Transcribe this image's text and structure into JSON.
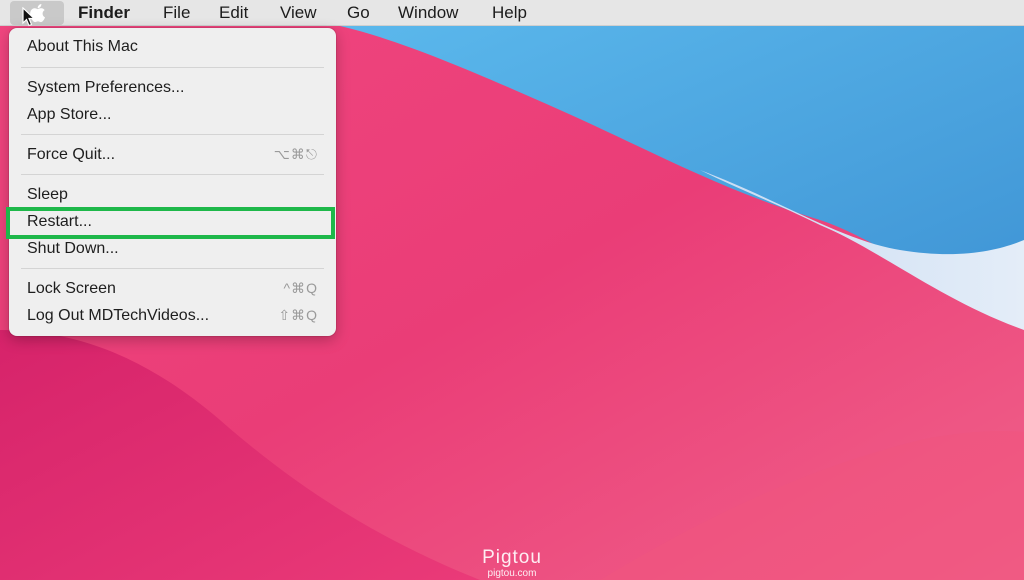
{
  "menubar": {
    "apple_icon": "apple-logo-icon",
    "items": [
      "Finder",
      "File",
      "Edit",
      "View",
      "Go",
      "Window",
      "Help"
    ]
  },
  "apple_menu": {
    "items": [
      {
        "label": "About This Mac",
        "shortcut": ""
      },
      {
        "label": "System Preferences...",
        "shortcut": ""
      },
      {
        "label": "App Store...",
        "shortcut": ""
      },
      {
        "label": "Force Quit...",
        "shortcut": "⌥⌘⎋"
      },
      {
        "label": "Sleep",
        "shortcut": ""
      },
      {
        "label": "Restart...",
        "shortcut": ""
      },
      {
        "label": "Shut Down...",
        "shortcut": ""
      },
      {
        "label": "Lock Screen",
        "shortcut": "^⌘Q"
      },
      {
        "label": "Log Out MDTechVideos...",
        "shortcut": "⇧⌘Q"
      }
    ],
    "highlighted_item": "Restart...",
    "highlight_color": "#1eb84a"
  },
  "watermark": {
    "name": "Pigtou",
    "url": "pigtou.com"
  },
  "colors": {
    "wallpaper_pink": "#e8336f",
    "wallpaper_blue": "#4aa6e0",
    "menu_background": "#efefef"
  }
}
